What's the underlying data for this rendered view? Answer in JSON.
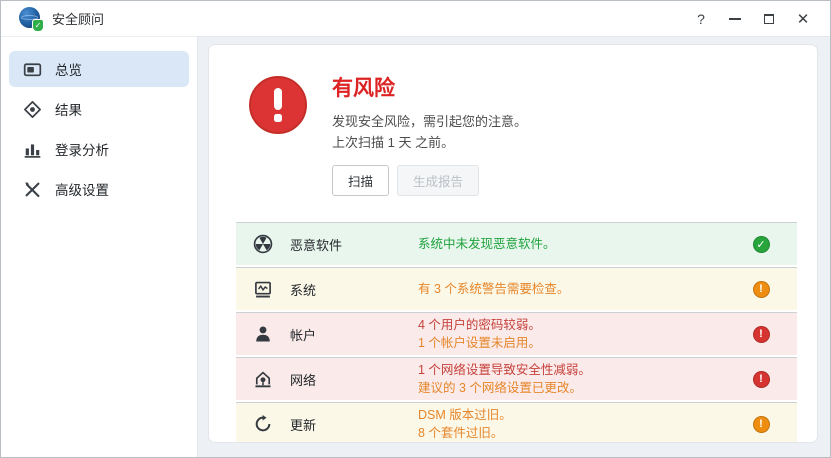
{
  "titlebar": {
    "title": "安全顾问",
    "controls": {
      "help_glyph": "?",
      "close_glyph": "✕",
      "minimize": "minimize",
      "maximize": "maximize"
    }
  },
  "sidebar": {
    "items": [
      {
        "label": "总览",
        "icon": "overview-icon",
        "active": true
      },
      {
        "label": "结果",
        "icon": "results-icon",
        "active": false
      },
      {
        "label": "登录分析",
        "icon": "login-analysis-icon",
        "active": false
      },
      {
        "label": "高级设置",
        "icon": "advanced-settings-icon",
        "active": false
      }
    ]
  },
  "main": {
    "status": {
      "title": "有风险",
      "line1": "发现安全风险，需引起您的注意。",
      "line2": "上次扫描 1 天 之前。",
      "scan_button": "扫描",
      "report_button": "生成报告"
    },
    "status_glyphs": {
      "ok": "✓",
      "alert": "!"
    },
    "colors": {
      "risk_red": "#dd2424",
      "ok_green": "#27a53c",
      "warning_orange": "#ee8d10",
      "danger_red": "#d63430",
      "text_green": "#1ea23b",
      "text_orange": "#e6862a",
      "text_red": "#c6413c"
    },
    "rows": [
      {
        "category": "恶意软件",
        "icon": "malware-icon",
        "severity": "ok",
        "lines": [
          {
            "text": "系统中未发现恶意软件。",
            "color": "green"
          }
        ]
      },
      {
        "category": "系统",
        "icon": "system-icon",
        "severity": "warning",
        "lines": [
          {
            "text": "有 3 个系统警告需要检查。",
            "color": "orange"
          }
        ]
      },
      {
        "category": "帐户",
        "icon": "account-icon",
        "severity": "danger",
        "lines": [
          {
            "text": "4 个用户的密码较弱。",
            "color": "red"
          },
          {
            "text": "1 个帐户设置未启用。",
            "color": "orange"
          }
        ]
      },
      {
        "category": "网络",
        "icon": "network-icon",
        "severity": "danger",
        "lines": [
          {
            "text": "1 个网络设置导致安全性减弱。",
            "color": "red"
          },
          {
            "text": "建议的 3 个网络设置已更改。",
            "color": "orange"
          }
        ]
      },
      {
        "category": "更新",
        "icon": "update-icon",
        "severity": "warning",
        "lines": [
          {
            "text": "DSM 版本过旧。",
            "color": "orange"
          },
          {
            "text": "8 个套件过旧。",
            "color": "orange"
          }
        ]
      }
    ]
  }
}
